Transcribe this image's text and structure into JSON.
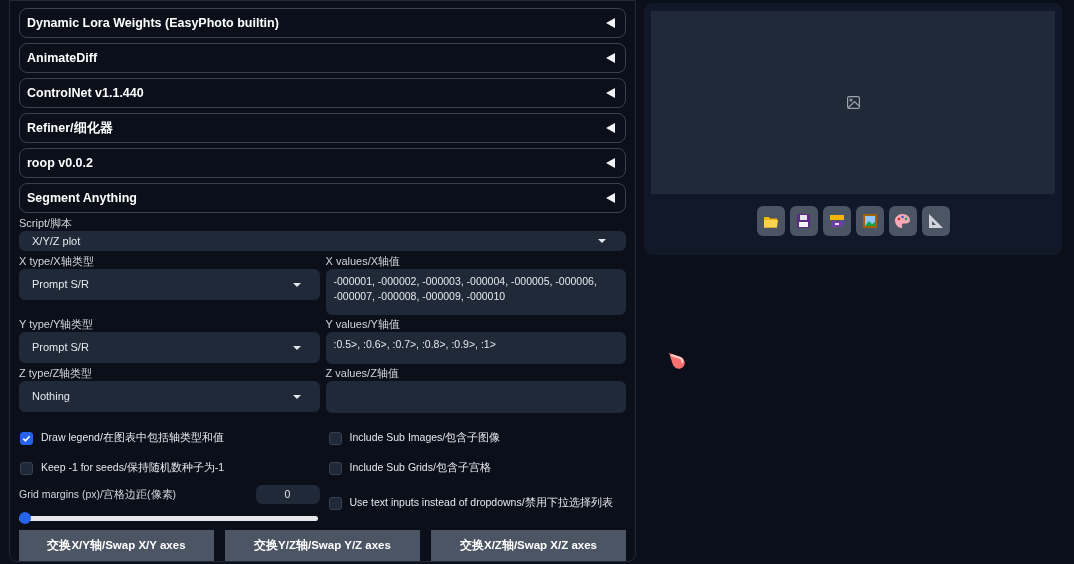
{
  "accordions": [
    {
      "label": "Dynamic Lora Weights (EasyPhoto builtin)",
      "expanded": false
    },
    {
      "label": "AnimateDiff",
      "expanded": false
    },
    {
      "label": "ControlNet v1.1.440",
      "expanded": false
    },
    {
      "label": "Refiner/细化器",
      "expanded": false
    },
    {
      "label": "roop v0.0.2",
      "expanded": false
    },
    {
      "label": "Segment Anything",
      "expanded": false
    }
  ],
  "script": {
    "label": "Script/脚本",
    "value": "X/Y/Z plot"
  },
  "axes": [
    {
      "type_label": "X type/X轴类型",
      "type_value": "Prompt S/R",
      "values_label": "X values/X轴值",
      "values": "-000001, -000002, -000003, -000004, -000005, -000006, -000007, -000008, -000009, -000010"
    },
    {
      "type_label": "Y type/Y轴类型",
      "type_value": "Prompt S/R",
      "values_label": "Y values/Y轴值",
      "values": ":0.5>, :0.6>, :0.7>, :0.8>, :0.9>, :1>"
    },
    {
      "type_label": "Z type/Z轴类型",
      "type_value": "Nothing",
      "values_label": "Z values/Z轴值"
    }
  ],
  "left_options": [
    {
      "label": "Draw legend/在图表中包括轴类型和值",
      "checked": true
    },
    {
      "label": "Keep -1 for seeds/保持随机数种子为-1",
      "checked": false
    }
  ],
  "right_options": [
    {
      "label": "Include Sub Images/包含子图像",
      "checked": false
    },
    {
      "label": "Include Sub Grids/包含子宫格",
      "checked": false
    },
    {
      "label": "Use text inputs instead of dropdowns/禁用下拉选择列表",
      "checked": false
    }
  ],
  "grid_margins": {
    "label": "Grid margins (px)/宫格边距(像素)",
    "value": "0",
    "level": 0
  },
  "swap_buttons": [
    "交换X/Y轴/Swap X/Y axes",
    "交换Y/Z轴/Swap Y/Z axes",
    "交换X/Z轴/Swap X/Z axes"
  ],
  "image_toolbar": [
    {
      "kind": "folder"
    },
    {
      "kind": "save"
    },
    {
      "kind": "archive"
    },
    {
      "kind": "picture"
    },
    {
      "kind": "palette"
    },
    {
      "kind": "ruler"
    }
  ]
}
